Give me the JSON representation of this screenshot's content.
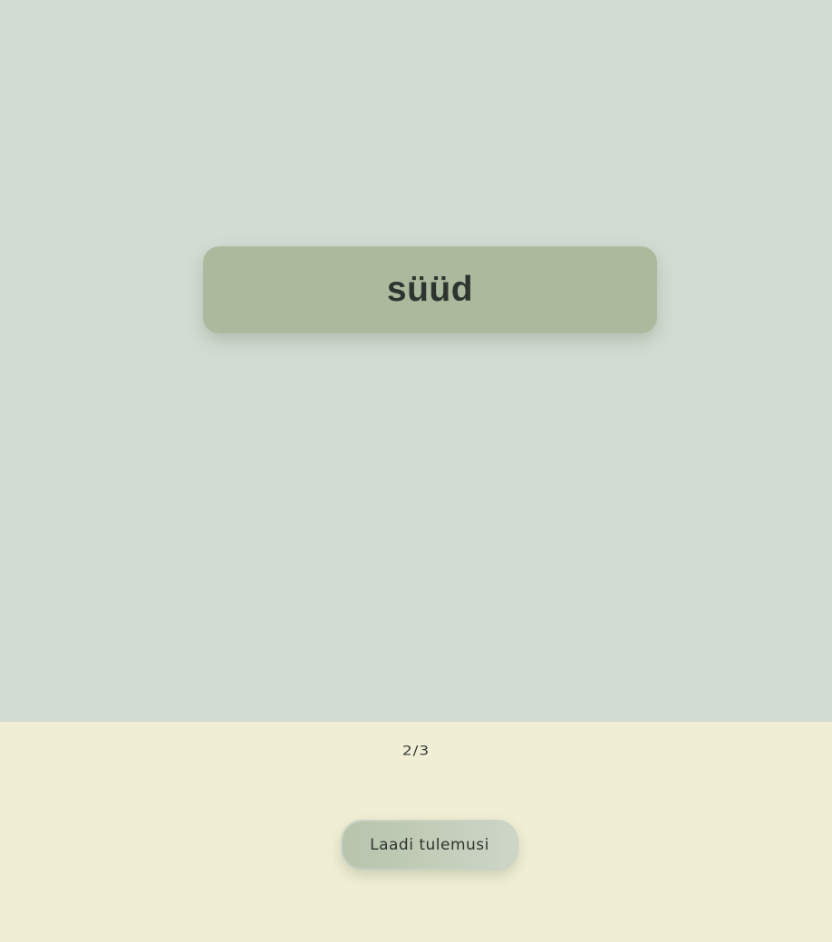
{
  "card": {
    "word": "süüd"
  },
  "footer": {
    "progress": "2/3",
    "load_button_label": "Laadi tulemusi"
  },
  "colors": {
    "main_background": "#d3dcd2",
    "card_background": "#abb99c",
    "footer_background": "#f0efd5",
    "text": "#2e3530"
  }
}
